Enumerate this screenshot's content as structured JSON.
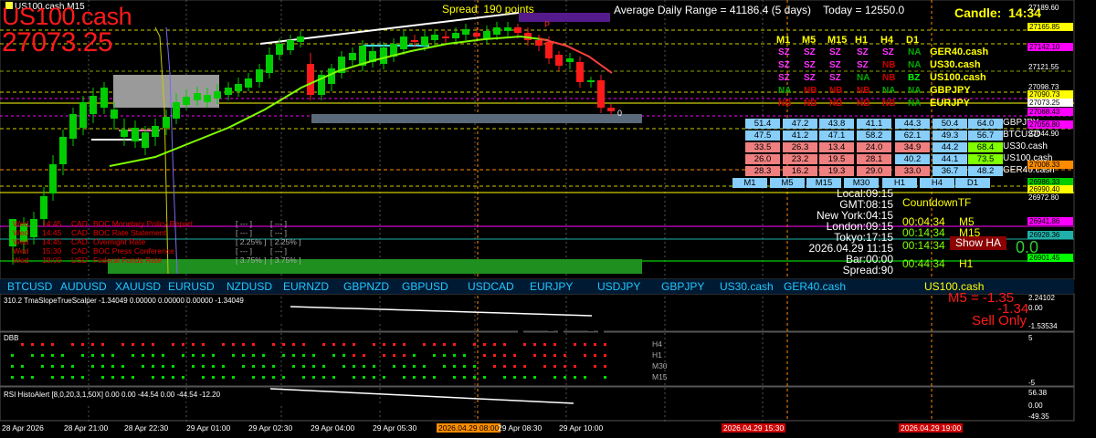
{
  "window_title": "US100.cash,M15",
  "symbol": "US100.cash",
  "price": "27073.25",
  "spread_label": "Spread",
  "spread_value": "190 points",
  "adr_text": "Average Daily Range = 41186.4 (5 days)",
  "today_text": "Today = 12550.0",
  "candle_label": "Candle:",
  "candle_time": "14:34",
  "pa_label": "P",
  "trend_matrix": {
    "timeframes": [
      "M1",
      "M5",
      "M15",
      "H1",
      "H4",
      "D1"
    ],
    "rows": [
      {
        "pair": "GER40.cash",
        "cells": [
          {
            "v": "SZ",
            "c": "#ff33ff"
          },
          {
            "v": "SZ",
            "c": "#ff33ff"
          },
          {
            "v": "SZ",
            "c": "#ff33ff"
          },
          {
            "v": "SZ",
            "c": "#ff33ff"
          },
          {
            "v": "SZ",
            "c": "#ff33ff"
          },
          {
            "v": "NA",
            "c": "#00aa00"
          }
        ]
      },
      {
        "pair": "US30.cash",
        "cells": [
          {
            "v": "SZ",
            "c": "#ff33ff"
          },
          {
            "v": "SZ",
            "c": "#ff33ff"
          },
          {
            "v": "SZ",
            "c": "#ff33ff"
          },
          {
            "v": "SZ",
            "c": "#ff33ff"
          },
          {
            "v": "NB",
            "c": "#cc0000"
          },
          {
            "v": "NA",
            "c": "#00aa00"
          }
        ]
      },
      {
        "pair": "US100.cash",
        "cells": [
          {
            "v": "SZ",
            "c": "#ff33ff"
          },
          {
            "v": "SZ",
            "c": "#ff33ff"
          },
          {
            "v": "SZ",
            "c": "#ff33ff"
          },
          {
            "v": "NA",
            "c": "#00aa00"
          },
          {
            "v": "NB",
            "c": "#cc0000"
          },
          {
            "v": "BZ",
            "c": "#00ff00"
          }
        ]
      },
      {
        "pair": "GBPJPY",
        "cells": [
          {
            "v": "NA",
            "c": "#00aa00"
          },
          {
            "v": "NB",
            "c": "#cc0000"
          },
          {
            "v": "NB",
            "c": "#cc0000"
          },
          {
            "v": "NB",
            "c": "#cc0000"
          },
          {
            "v": "NA",
            "c": "#00aa00"
          },
          {
            "v": "NA",
            "c": "#00aa00"
          }
        ]
      },
      {
        "pair": "EURJPY",
        "cells": [
          {
            "v": "NB",
            "c": "#cc0000"
          },
          {
            "v": "NB",
            "c": "#cc0000"
          },
          {
            "v": "NB",
            "c": "#cc0000"
          },
          {
            "v": "NB",
            "c": "#cc0000"
          },
          {
            "v": "NB",
            "c": "#cc0000"
          },
          {
            "v": "NA",
            "c": "#00aa00"
          }
        ]
      }
    ]
  },
  "strength_grid": {
    "timeframes": [
      "M1",
      "M5",
      "M15",
      "M30",
      "H1",
      "H4",
      "D1"
    ],
    "rows": [
      {
        "sym": "GBPJPY",
        "vals": [
          "51.4",
          "47.2",
          "43.8",
          "41.1",
          "44.3",
          "50.4",
          "64.0"
        ],
        "cols": [
          "#87cefa",
          "#87cefa",
          "#87cefa",
          "#87cefa",
          "#87cefa",
          "#87cefa",
          "#87cefa"
        ]
      },
      {
        "sym": "BTCUSD",
        "vals": [
          "47.5",
          "41.2",
          "47.1",
          "58.2",
          "62.1",
          "49.3",
          "56.7"
        ],
        "cols": [
          "#87cefa",
          "#87cefa",
          "#87cefa",
          "#87cefa",
          "#87cefa",
          "#87cefa",
          "#87cefa"
        ]
      },
      {
        "sym": "US30.cash",
        "vals": [
          "33.5",
          "26.3",
          "13.4",
          "24.0",
          "34.9",
          "44.2",
          "68.4"
        ],
        "cols": [
          "#f08080",
          "#f08080",
          "#f08080",
          "#f08080",
          "#f08080",
          "#87cefa",
          "#7fff00"
        ]
      },
      {
        "sym": "US100.cash",
        "vals": [
          "26.0",
          "23.2",
          "19.5",
          "28.1",
          "40.2",
          "44.1",
          "73.5"
        ],
        "cols": [
          "#f08080",
          "#f08080",
          "#f08080",
          "#f08080",
          "#87cefa",
          "#87cefa",
          "#7fff00"
        ]
      },
      {
        "sym": "GER40.cash",
        "vals": [
          "28.3",
          "16.2",
          "19.3",
          "29.0",
          "33.0",
          "36.7",
          "48.2"
        ],
        "cols": [
          "#f08080",
          "#f08080",
          "#f08080",
          "#f08080",
          "#f08080",
          "#87cefa",
          "#87cefa"
        ]
      }
    ]
  },
  "clocks": [
    {
      "label": "Local:09:15"
    },
    {
      "label": "GMT:08:15"
    },
    {
      "label": "New York:04:15"
    },
    {
      "label": "London:09:15"
    },
    {
      "label": "Tokyo:17:15"
    },
    {
      "label": "2026.04.29 11:15"
    },
    {
      "label": "Bar:00:00"
    },
    {
      "label": "Spread:90"
    }
  ],
  "countdown": {
    "title": "CountdownTF",
    "rows": [
      {
        "time": "00:04:34",
        "tf": "M5",
        "color": "#ffff00"
      },
      {
        "time": "00:14:34",
        "tf": "M15",
        "color": "#ffff00"
      },
      {
        "time": "00:14:34",
        "tf": "M30",
        "color": "#ffff00"
      },
      {
        "time": "00:44:34",
        "tf": "H1",
        "color": "#ffff00"
      }
    ]
  },
  "show_ha": {
    "label": "Show HA",
    "value": "0.0"
  },
  "news": [
    {
      "day": "Wed",
      "time": "14:45",
      "cur": "CAD",
      "event": "BOC Monetary Policy Report",
      "f": "[ --- ]",
      "p": "[ --- ]"
    },
    {
      "day": "Wed",
      "time": "14:45",
      "cur": "CAD",
      "event": "BOC Rate Statement",
      "f": "[ --- ]",
      "p": "[ --- ]"
    },
    {
      "day": "Wed",
      "time": "14:45",
      "cur": "CAD",
      "event": "Overnight Rate",
      "f": "[ 2.25% ]",
      "p": "[ 2.25% ]"
    },
    {
      "day": "Wed",
      "time": "15:30",
      "cur": "CAD",
      "event": "BOC Press Conference",
      "f": "[ --- ]",
      "p": "[ --- ]"
    },
    {
      "day": "Wed",
      "time": "19:00",
      "cur": "USD",
      "event": "Federal Funds Rate",
      "f": "[ 3.75% ]",
      "p": "[ 3.75% ]"
    }
  ],
  "symbols_bar": [
    "BTCUSD",
    "AUDUSD",
    "XAUUSD",
    "EURUSD",
    "NZDUSD",
    "EURNZD",
    "GBPNZD",
    "GBPUSD",
    "USDCAD",
    "EURJPY",
    "USDJPY",
    "GBPJPY",
    "US30.cash",
    "GER40.cash"
  ],
  "symbols_bar_active": "US100.cash",
  "price_axis": [
    "27189.60",
    "27165.85",
    "27142.10",
    "27121.55",
    "27098.73",
    "27090.73",
    "27073.25",
    "27068.43",
    "27056.80",
    "27044.90",
    "27008.33",
    "26986.33",
    "26990.40",
    "26972.80",
    "26941.86",
    "26928.36",
    "26901.45"
  ],
  "indicator1": {
    "label": "310.2 TmaSlopeTrueScalper -1.34049 0.00000 0.00000 0.00000 -1.34049",
    "axis": [
      "2.24102",
      "0.00",
      "-1.53534"
    ],
    "m5_label": "M5 = -1.35",
    "m5_value": "-1.34",
    "signal": "Sell Only"
  },
  "indicator2": {
    "label": "DBB",
    "axis": [
      "5",
      "-5"
    ],
    "tfs": [
      "H4",
      "H1",
      "M30",
      "M15"
    ]
  },
  "indicator3": {
    "label": "RSI HistoAlert [8,0,20,3,1,50X] 0.00 0.00 -44.54 0.00 -44.54 -12.20",
    "axis": [
      "56.38",
      "0.00",
      "-49.35"
    ]
  },
  "time_axis": [
    "28 Apr 2026",
    "28 Apr 21:00",
    "28 Apr 22:30",
    "29 Apr 01:00",
    "29 Apr 02:30",
    "29 Apr 04:00",
    "29 Apr 05:30",
    "2026.04.29 08:00",
    "29 Apr 08:30",
    "29 Apr 10:00"
  ],
  "time_markers": [
    "2026.04.29 15:30",
    "2026.04.29 19:00"
  ],
  "ha_marker": "0"
}
